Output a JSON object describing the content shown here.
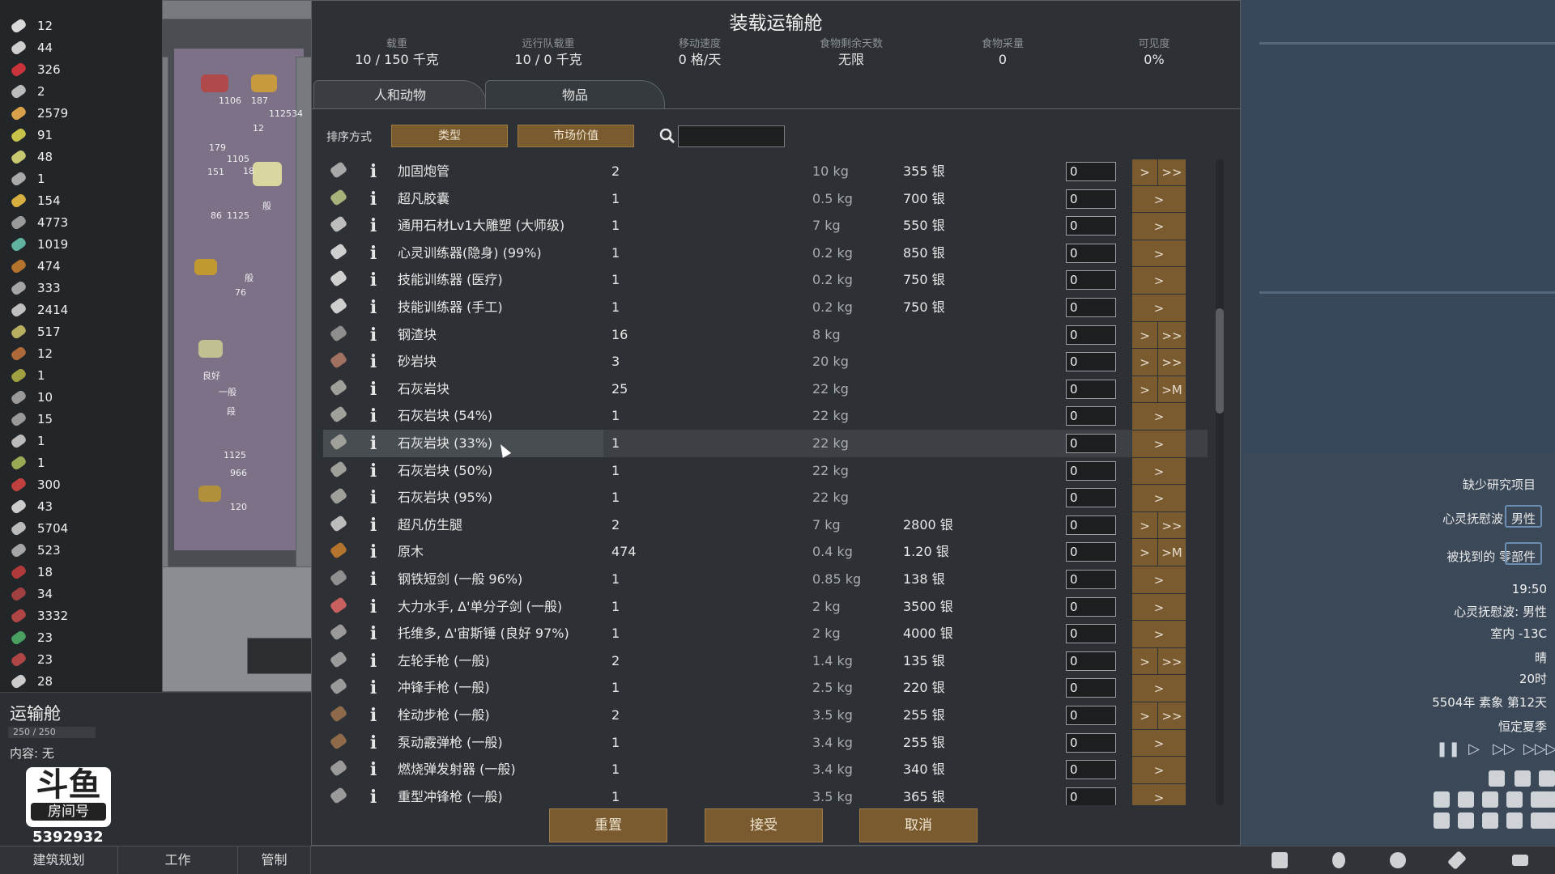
{
  "resources": [
    {
      "value": "12",
      "icon": "resource-icon",
      "color": "#d9d9d9"
    },
    {
      "value": "44",
      "icon": "resource-icon",
      "color": "#cfcfcf"
    },
    {
      "value": "326",
      "icon": "medicine-icon",
      "color": "#c8343a"
    },
    {
      "value": "2",
      "icon": "resource-icon",
      "color": "#bbbbbb"
    },
    {
      "value": "2579",
      "icon": "resource-icon",
      "color": "#d9a24a"
    },
    {
      "value": "91",
      "icon": "resource-icon",
      "color": "#c8c24a"
    },
    {
      "value": "48",
      "icon": "resource-icon",
      "color": "#c8c870"
    },
    {
      "value": "1",
      "icon": "resource-icon",
      "color": "#aaaaaa"
    },
    {
      "value": "154",
      "icon": "resource-icon",
      "color": "#d8b040"
    },
    {
      "value": "4773",
      "icon": "resource-icon",
      "color": "#9a9a9a"
    },
    {
      "value": "1019",
      "icon": "resource-icon",
      "color": "#5fb3a0"
    },
    {
      "value": "474",
      "icon": "wood-icon",
      "color": "#b5742e"
    },
    {
      "value": "333",
      "icon": "resource-icon",
      "color": "#a5a5a5"
    },
    {
      "value": "2414",
      "icon": "resource-icon",
      "color": "#c0c0c0"
    },
    {
      "value": "517",
      "icon": "resource-icon",
      "color": "#b8b060"
    },
    {
      "value": "12",
      "icon": "resource-icon",
      "color": "#b06a3a"
    },
    {
      "value": "1",
      "icon": "resource-icon",
      "color": "#a0a040"
    },
    {
      "value": "10",
      "icon": "resource-icon",
      "color": "#9a9a9a"
    },
    {
      "value": "15",
      "icon": "resource-icon",
      "color": "#999999"
    },
    {
      "value": "1",
      "icon": "resource-icon",
      "color": "#bbbbbb"
    },
    {
      "value": "1",
      "icon": "resource-icon",
      "color": "#99aa55"
    },
    {
      "value": "300",
      "icon": "resource-icon",
      "color": "#c04040"
    },
    {
      "value": "43",
      "icon": "resource-icon",
      "color": "#cccccc"
    },
    {
      "value": "5704",
      "icon": "resource-icon",
      "color": "#bbbbbb"
    },
    {
      "value": "523",
      "icon": "resource-icon",
      "color": "#a5a5a5"
    },
    {
      "value": "18",
      "icon": "resource-icon",
      "color": "#b03a3a"
    },
    {
      "value": "34",
      "icon": "resource-icon",
      "color": "#a04040"
    },
    {
      "value": "3332",
      "icon": "resource-icon",
      "color": "#b04545"
    },
    {
      "value": "23",
      "icon": "resource-icon",
      "color": "#4aa060"
    },
    {
      "value": "23",
      "icon": "resource-icon",
      "color": "#b04545"
    },
    {
      "value": "28",
      "icon": "resource-icon",
      "color": "#cccccc"
    }
  ],
  "map_labels": [
    "1106",
    "187",
    "1125",
    "34",
    "12",
    "179",
    "1105",
    "18",
    "151",
    "86",
    "1125",
    "般",
    "76",
    "般",
    "良好",
    "一般",
    "段",
    "1125",
    "966",
    "120"
  ],
  "inspect": {
    "title": "运输舱",
    "capacity": "250 / 250",
    "content": "内容: 无",
    "logo_top": "斗鱼",
    "logo_bottom": "房间号",
    "room_id": "5392932"
  },
  "bottom_bar": {
    "buttons": [
      "建筑规划",
      "工作",
      "管制"
    ],
    "icons": [
      "architect-icon",
      "research-icon",
      "person-icon",
      "world-icon",
      "menu-icon"
    ]
  },
  "dialog": {
    "title": "装载运输舱",
    "stats": [
      {
        "label": "载重",
        "value": "10 / 150 千克"
      },
      {
        "label": "远行队载重",
        "value": "10 / 0 千克"
      },
      {
        "label": "移动速度",
        "value": "0 格/天"
      },
      {
        "label": "食物剩余天数",
        "value": "无限"
      },
      {
        "label": "食物采量",
        "value": "0"
      },
      {
        "label": "可见度",
        "value": "0%"
      }
    ],
    "tabs": [
      {
        "label": "人和动物",
        "active": false
      },
      {
        "label": "物品",
        "active": true
      }
    ],
    "sort_label": "排序方式",
    "sort_buttons": [
      "类型",
      "市场价值"
    ],
    "search": {
      "placeholder": "",
      "value": ""
    },
    "footer_buttons": [
      "重置",
      "接受",
      "取消"
    ],
    "accent_color": "#7a5b30"
  },
  "items": [
    {
      "name": "加固炮管",
      "count": "2",
      "mass": "10 kg",
      "value": "355 银",
      "input": "0",
      "buttons": [
        ">",
        ">>"
      ],
      "icon_color": "#a8a8a8"
    },
    {
      "name": "超凡胶囊",
      "count": "1",
      "mass": "0.5 kg",
      "value": "700 银",
      "input": "0",
      "buttons": [
        ">"
      ],
      "icon_color": "#a6b27a"
    },
    {
      "name": "通用石材Lv1大雕塑 (大师级)",
      "count": "1",
      "mass": "7 kg",
      "value": "550 银",
      "input": "0",
      "buttons": [
        ">"
      ],
      "icon_color": "#bdbdbd"
    },
    {
      "name": "心灵训练器(隐身) (99%)",
      "count": "1",
      "mass": "0.2 kg",
      "value": "850 银",
      "input": "0",
      "buttons": [
        ">"
      ],
      "icon_color": "#cfcfcf"
    },
    {
      "name": "技能训练器 (医疗)",
      "count": "1",
      "mass": "0.2 kg",
      "value": "750 银",
      "input": "0",
      "buttons": [
        ">"
      ],
      "icon_color": "#cfcfcf"
    },
    {
      "name": "技能训练器 (手工)",
      "count": "1",
      "mass": "0.2 kg",
      "value": "750 银",
      "input": "0",
      "buttons": [
        ">"
      ],
      "icon_color": "#cfcfcf"
    },
    {
      "name": "钢渣块",
      "count": "16",
      "mass": "8 kg",
      "value": "",
      "input": "0",
      "buttons": [
        ">",
        ">>"
      ],
      "icon_color": "#8e8e8e"
    },
    {
      "name": "砂岩块",
      "count": "3",
      "mass": "20 kg",
      "value": "",
      "input": "0",
      "buttons": [
        ">",
        ">>"
      ],
      "icon_color": "#a07060"
    },
    {
      "name": "石灰岩块",
      "count": "25",
      "mass": "22 kg",
      "value": "",
      "input": "0",
      "buttons": [
        ">",
        ">M"
      ],
      "icon_color": "#a0a09a"
    },
    {
      "name": "石灰岩块 (54%)",
      "count": "1",
      "mass": "22 kg",
      "value": "",
      "input": "0",
      "buttons": [
        ">"
      ],
      "icon_color": "#a0a09a"
    },
    {
      "name": "石灰岩块 (33%)",
      "count": "1",
      "mass": "22 kg",
      "value": "",
      "input": "0",
      "buttons": [
        ">"
      ],
      "icon_color": "#a0a09a",
      "highlight": true
    },
    {
      "name": "石灰岩块 (50%)",
      "count": "1",
      "mass": "22 kg",
      "value": "",
      "input": "0",
      "buttons": [
        ">"
      ],
      "icon_color": "#a0a09a"
    },
    {
      "name": "石灰岩块 (95%)",
      "count": "1",
      "mass": "22 kg",
      "value": "",
      "input": "0",
      "buttons": [
        ">"
      ],
      "icon_color": "#a0a09a"
    },
    {
      "name": "超凡仿生腿",
      "count": "2",
      "mass": "7 kg",
      "value": "2800 银",
      "input": "0",
      "buttons": [
        ">",
        ">>"
      ],
      "icon_color": "#bcbcbc"
    },
    {
      "name": "原木",
      "count": "474",
      "mass": "0.4 kg",
      "value": "1.20 银",
      "input": "0",
      "buttons": [
        ">",
        ">M"
      ],
      "icon_color": "#b5742e"
    },
    {
      "name": "钢铁短剑 (一般 96%)",
      "count": "1",
      "mass": "0.85 kg",
      "value": "138 银",
      "input": "0",
      "buttons": [
        ">"
      ],
      "icon_color": "#8f8f8f"
    },
    {
      "name": "大力水手, Δ'单分子剑 (一般)",
      "count": "1",
      "mass": "2 kg",
      "value": "3500 银",
      "input": "0",
      "buttons": [
        ">"
      ],
      "icon_color": "#c86060"
    },
    {
      "name": "托维多, Δ'宙斯锤 (良好 97%)",
      "count": "1",
      "mass": "2 kg",
      "value": "4000 银",
      "input": "0",
      "buttons": [
        ">"
      ],
      "icon_color": "#9a9a9a"
    },
    {
      "name": "左轮手枪 (一般)",
      "count": "2",
      "mass": "1.4 kg",
      "value": "135 银",
      "input": "0",
      "buttons": [
        ">",
        ">>"
      ],
      "icon_color": "#9a9a9a"
    },
    {
      "name": "冲锋手枪 (一般)",
      "count": "1",
      "mass": "2.5 kg",
      "value": "220 银",
      "input": "0",
      "buttons": [
        ">"
      ],
      "icon_color": "#9a9a9a"
    },
    {
      "name": "栓动步枪 (一般)",
      "count": "2",
      "mass": "3.5 kg",
      "value": "255 银",
      "input": "0",
      "buttons": [
        ">",
        ">>"
      ],
      "icon_color": "#8f6a4a"
    },
    {
      "name": "泵动霰弹枪 (一般)",
      "count": "1",
      "mass": "3.4 kg",
      "value": "255 银",
      "input": "0",
      "buttons": [
        ">"
      ],
      "icon_color": "#8f6a4a"
    },
    {
      "name": "燃烧弹发射器 (一般)",
      "count": "1",
      "mass": "3.4 kg",
      "value": "340 银",
      "input": "0",
      "buttons": [
        ">"
      ],
      "icon_color": "#9a9a9a"
    },
    {
      "name": "重型冲锋枪 (一般)",
      "count": "1",
      "mass": "3.5 kg",
      "value": "365 银",
      "input": "0",
      "buttons": [
        ">"
      ],
      "icon_color": "#9a9a9a"
    }
  ],
  "right": {
    "alerts": [
      "缺少研究项目",
      "心灵抚慰波: 男性",
      "被找到的 零部件"
    ],
    "info": [
      "19:50",
      "心灵抚慰波: 男性",
      "室内 -13C",
      "晴",
      "20时",
      "5504年 素象 第12天",
      "恒定夏季"
    ],
    "speed_icons": [
      "pause-icon",
      "play-icon",
      "fast-icon",
      "fastest-icon"
    ],
    "overlay_icons": [
      "overlay-icon-1",
      "overlay-icon-2",
      "overlay-icon-3",
      "overlay-icon-4",
      "overlay-icon-5",
      "overlay-icon-6",
      "overlay-icon-7",
      "overlay-icon-8",
      "overlay-icon-9",
      "overlay-icon-10",
      "overlay-icon-11",
      "overlay-icon-12",
      "overlay-icon-13",
      "overlay-icon-14",
      "overlay-icon-15"
    ]
  }
}
